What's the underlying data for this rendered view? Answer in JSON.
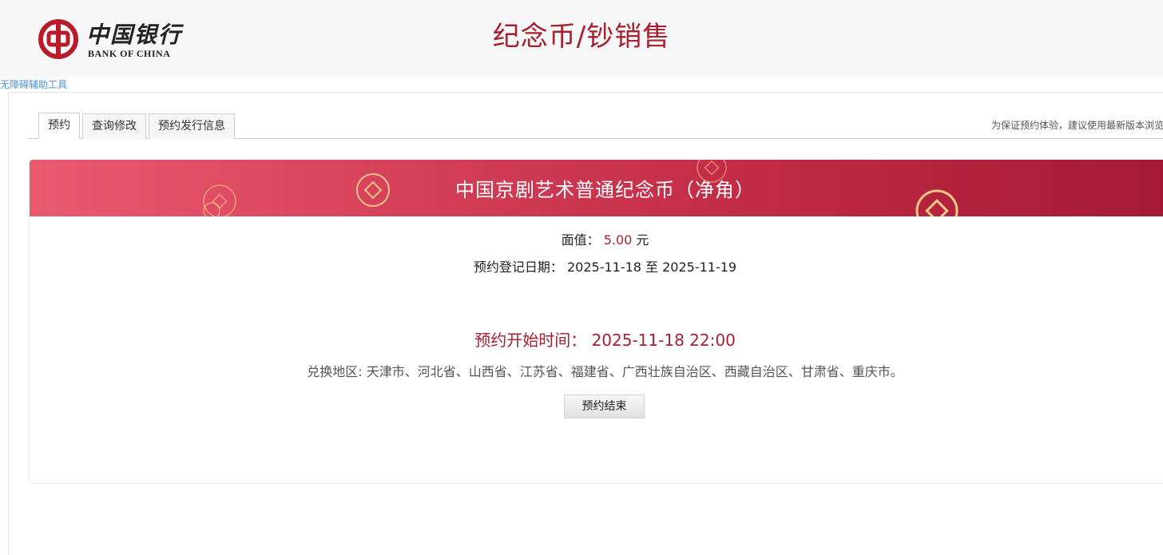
{
  "header": {
    "logo": {
      "cn_text": "中国银行",
      "en_text": "BANK OF CHINA",
      "icon": "bank-of-china-logo-icon",
      "brand_color": "#b81c2c"
    },
    "title": "纪念币/钞销售",
    "accessibility_link": "无障碍辅助工具"
  },
  "tabs": {
    "items": [
      {
        "label": "预约",
        "active": true
      },
      {
        "label": "查询修改",
        "active": false
      },
      {
        "label": "预约发行信息",
        "active": false
      }
    ],
    "notice": "为保证预约体验，建议使用最新版本浏览"
  },
  "coin": {
    "name": "中国京剧艺术普通纪念币（净角）",
    "face_value_label": "面值：",
    "face_value": "5.00",
    "face_value_unit": "元",
    "date_label": "预约登记日期：",
    "date_range": "2025-11-18 至 2025-11-19",
    "start_time_label": "预约开始时间：",
    "start_time": "2025-11-18 22:00",
    "region_label": "兑换地区:",
    "regions": "天津市、河北省、山西省、江苏省、福建省、广西壮族自治区、西藏自治区、甘肃省、重庆市。",
    "status_button": "预约结束"
  },
  "colors": {
    "accent": "#a7202f",
    "banner_start": "#ea5a6f",
    "banner_end": "#a51a33",
    "link": "#4a90d9"
  }
}
